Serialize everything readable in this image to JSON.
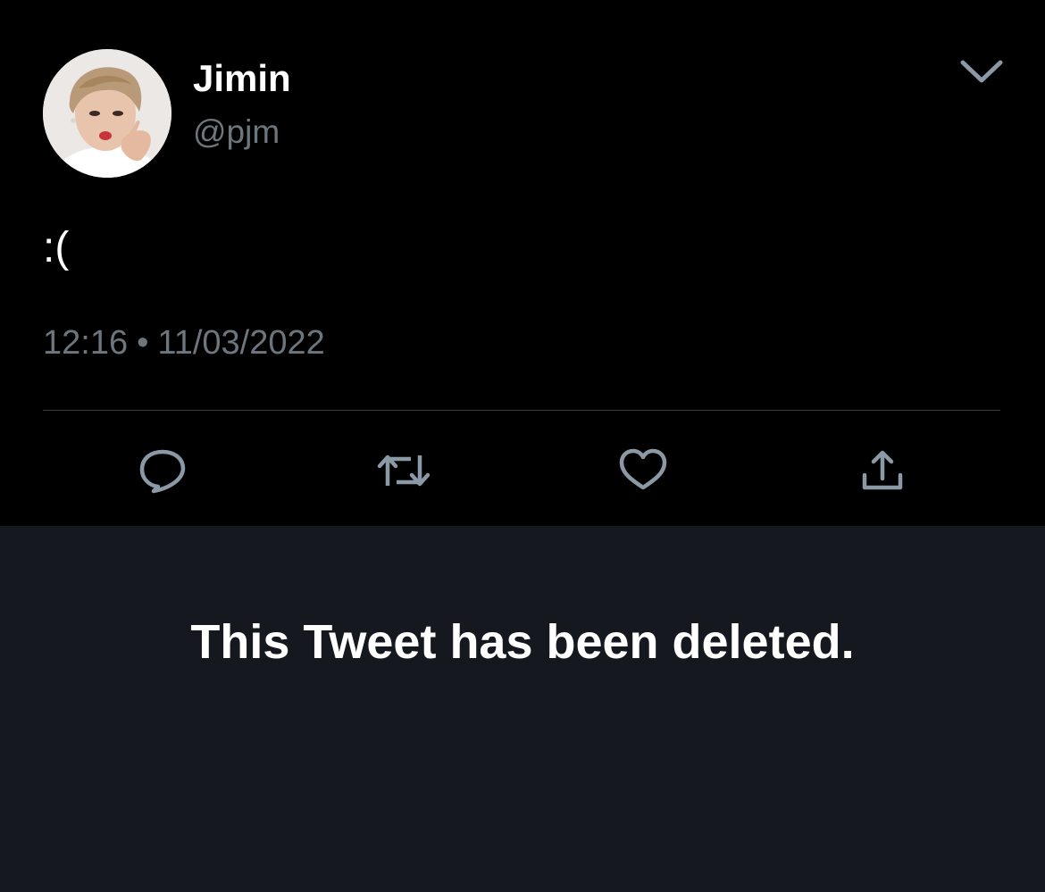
{
  "tweet": {
    "author": {
      "display_name": "Jimin",
      "handle": "@pjm",
      "avatar_icon": "profile-photo"
    },
    "text": ":(",
    "time": "12:16",
    "separator": "•",
    "date": "11/03/2022",
    "menu_icon": "chevron-down-icon",
    "actions": [
      {
        "name": "reply",
        "icon": "speech-bubble-icon"
      },
      {
        "name": "retweet",
        "icon": "retweet-arrows-icon"
      },
      {
        "name": "like",
        "icon": "heart-icon"
      },
      {
        "name": "share",
        "icon": "upload-arrow-icon"
      }
    ]
  },
  "deleted_notice": {
    "message": "This Tweet has been deleted."
  },
  "colors": {
    "background": "#000000",
    "panel": "#15181f",
    "text_primary": "#ffffff",
    "text_secondary": "#6e767d",
    "icon": "#8b98a5",
    "divider": "#3a3e42"
  }
}
